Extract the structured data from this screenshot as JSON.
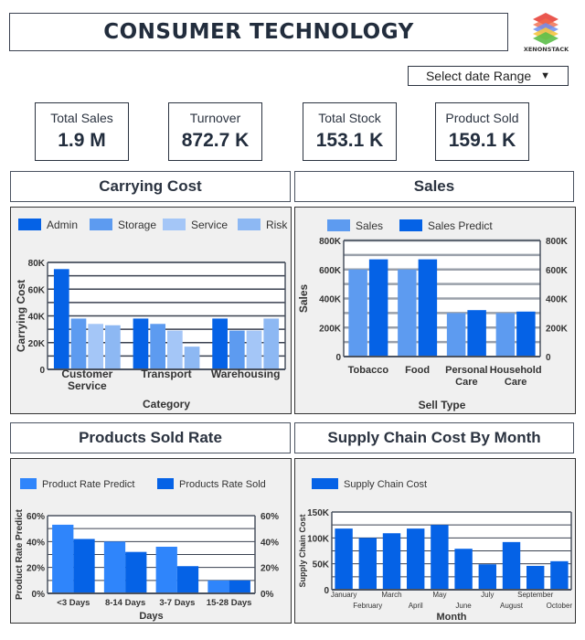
{
  "header": {
    "title": "CONSUMER TECHNOLOGY",
    "logo_text": "XENONSTACK",
    "date_select_label": "Select date Range",
    "date_select_icon": "triangle-down-icon"
  },
  "kpis": [
    {
      "label": "Total Sales",
      "value": "1.9 M"
    },
    {
      "label": "Turnover",
      "value": "872.7 K"
    },
    {
      "label": "Total Stock",
      "value": "153.1 K"
    },
    {
      "label": "Product Sold",
      "value": "159.1 K"
    }
  ],
  "sections": {
    "carrying_cost": "Carrying Cost",
    "sales": "Sales",
    "products_sold_rate": "Products Sold Rate",
    "supply_chain": "Supply Chain Cost By Month"
  },
  "colors": {
    "dark_blue": "#0562e6",
    "mid_blue": "#5d9bf0",
    "light_blue": "#a4c6f7",
    "pale_blue": "#8db8f3",
    "bright_blue": "#2f85fb",
    "panel_bg": "#f0f0f0"
  },
  "chart_data": [
    {
      "id": "carrying",
      "type": "bar",
      "title": "Carrying Cost",
      "xlabel": "Category",
      "ylabel": "Carrying Cost",
      "categories": [
        "Customer Service",
        "Transport",
        "Warehousing"
      ],
      "category_lines": [
        [
          "Customer",
          "Service"
        ],
        [
          "Transport"
        ],
        [
          "Warehousing"
        ]
      ],
      "series": [
        {
          "name": "Admin",
          "color": "#0562e6",
          "values": [
            75000,
            38000,
            38000
          ]
        },
        {
          "name": "Storage",
          "color": "#5d9bf0",
          "values": [
            38000,
            34000,
            29000
          ]
        },
        {
          "name": "Service",
          "color": "#a4c6f7",
          "values": [
            34000,
            29000,
            29000
          ]
        },
        {
          "name": "Risk",
          "color": "#8db8f3",
          "values": [
            33000,
            17000,
            38000
          ]
        }
      ],
      "ylim": [
        0,
        80000
      ],
      "yticks": [
        0,
        20000,
        40000,
        60000,
        80000
      ],
      "ytick_labels": [
        "0",
        "20K",
        "40K",
        "60K",
        "80K"
      ],
      "grid_step": 10000,
      "grid": true,
      "legend": "top"
    },
    {
      "id": "sales",
      "type": "bar",
      "title": "Sales",
      "xlabel": "Sell Type",
      "ylabel": "Sales",
      "categories": [
        "Tobacco",
        "Food",
        "Personal Care",
        "Household Care"
      ],
      "category_lines": [
        [
          "Tobacco"
        ],
        [
          "Food"
        ],
        [
          "Personal",
          "Care"
        ],
        [
          "Household",
          "Care"
        ]
      ],
      "series": [
        {
          "name": "Sales",
          "color": "#5d9bf0",
          "values": [
            600000,
            600000,
            300000,
            300000
          ]
        },
        {
          "name": "Sales Predict",
          "color": "#0562e6",
          "values": [
            670000,
            670000,
            320000,
            310000
          ]
        }
      ],
      "ylim": [
        0,
        800000
      ],
      "yticks": [
        0,
        200000,
        400000,
        600000,
        800000
      ],
      "ytick_labels": [
        "0",
        "200K",
        "400K",
        "600K",
        "800K"
      ],
      "right_axis": true,
      "grid_step": 100000,
      "grid": true,
      "legend": "top"
    },
    {
      "id": "rate",
      "type": "bar",
      "title": "Products Sold Rate",
      "xlabel": "Days",
      "ylabel": "Product Rate Predict",
      "categories": [
        "<3 Days",
        "8-14 Days",
        "3-7 Days",
        "15-28 Days"
      ],
      "category_lines": [
        [
          "<3 Days"
        ],
        [
          "8-14 Days"
        ],
        [
          "3-7 Days"
        ],
        [
          "15-28 Days"
        ]
      ],
      "series": [
        {
          "name": "Product Rate Predict",
          "color": "#2f85fb",
          "values": [
            53,
            40,
            36,
            10
          ]
        },
        {
          "name": "Products Rate Sold",
          "color": "#0562e6",
          "values": [
            42,
            32,
            21,
            10
          ]
        }
      ],
      "ylim": [
        0,
        60
      ],
      "yticks": [
        0,
        20,
        40,
        60
      ],
      "ytick_labels": [
        "0%",
        "20%",
        "40%",
        "60%"
      ],
      "right_axis": true,
      "grid_step": 10,
      "grid": true,
      "legend": "top"
    },
    {
      "id": "supply",
      "type": "bar",
      "title": "Supply Chain Cost By Month",
      "xlabel": "Month",
      "ylabel": "Supply Chain Cost",
      "categories": [
        "January",
        "February",
        "March",
        "April",
        "May",
        "June",
        "July",
        "August",
        "September",
        "October"
      ],
      "category_lines": [
        [
          "January"
        ],
        [
          "February"
        ],
        [
          "March"
        ],
        [
          "April"
        ],
        [
          "May"
        ],
        [
          "June"
        ],
        [
          "July"
        ],
        [
          "August"
        ],
        [
          "September"
        ],
        [
          "October"
        ]
      ],
      "series": [
        {
          "name": "Supply Chain Cost",
          "color": "#0562e6",
          "values": [
            118000,
            100000,
            109000,
            118000,
            125000,
            79000,
            49000,
            92000,
            46000,
            55000
          ]
        }
      ],
      "ylim": [
        0,
        150000
      ],
      "yticks": [
        0,
        50000,
        100000,
        150000
      ],
      "ytick_labels": [
        "0",
        "50K",
        "100K",
        "150K"
      ],
      "grid_step": 25000,
      "grid": true,
      "staggered_labels": true,
      "legend": "top-left"
    }
  ]
}
